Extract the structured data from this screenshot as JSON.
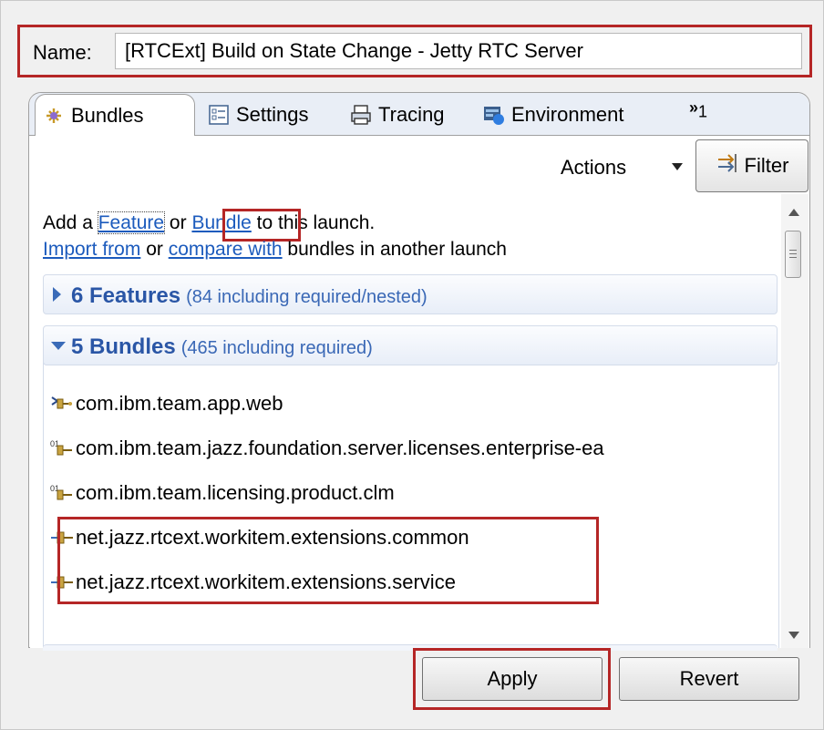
{
  "launch": {
    "name_label": "Name:",
    "name_value": "[RTCExt] Build on State Change - Jetty RTC Server"
  },
  "tabs": [
    {
      "label": "Bundles",
      "active": true,
      "icon": "bundles-icon"
    },
    {
      "label": "Settings",
      "active": false,
      "icon": "settings-icon"
    },
    {
      "label": "Tracing",
      "active": false,
      "icon": "tracing-icon"
    },
    {
      "label": "Environment",
      "active": false,
      "icon": "environment-icon"
    }
  ],
  "tab_overflow": {
    "chevron": "»",
    "count": "1"
  },
  "toolbar": {
    "actions_label": "Actions",
    "filter_label": "Filter"
  },
  "intro": {
    "add_prefix": "Add a ",
    "feature_link": "Feature",
    "or_text": " or ",
    "bundle_link": "Bundle",
    "add_suffix": " to this launch.",
    "import_link": "Import from",
    "or_text2": " or ",
    "compare_link": "compare with",
    "compare_suffix": " bundles in another launch"
  },
  "features_section": {
    "title": "6 Features",
    "subtitle": "(84 including required/nested)",
    "expanded": false
  },
  "bundles_section": {
    "title": "5 Bundles",
    "subtitle": "(465 including required)",
    "expanded": true
  },
  "bundles": [
    {
      "name": "com.ibm.team.app.web",
      "icon": "workspace-bundle-icon"
    },
    {
      "name": "com.ibm.team.jazz.foundation.server.licenses.enterprise-ea",
      "icon": "binary-bundle-icon"
    },
    {
      "name": "com.ibm.team.licensing.product.clm",
      "icon": "binary-bundle-icon"
    },
    {
      "name": "net.jazz.rtcext.workitem.extensions.common",
      "icon": "plugin-bundle-icon"
    },
    {
      "name": "net.jazz.rtcext.workitem.extensions.service",
      "icon": "plugin-bundle-icon"
    }
  ],
  "buttons": {
    "apply": "Apply",
    "revert": "Revert"
  },
  "colors": {
    "highlight": "#b52626",
    "link": "#1c5bbd",
    "section_title": "#2a56a6"
  }
}
